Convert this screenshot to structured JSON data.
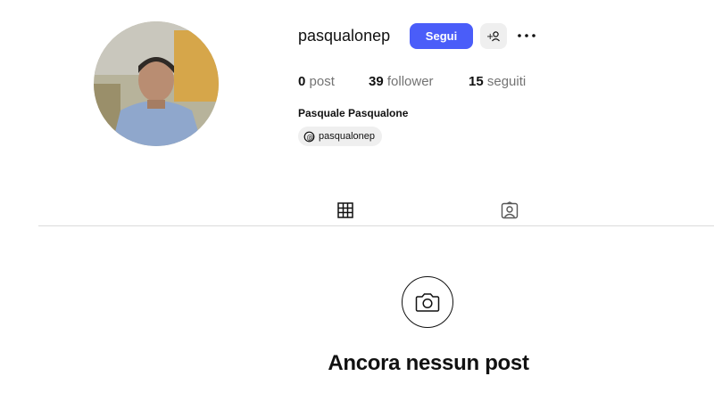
{
  "profile": {
    "username": "pasqualonep",
    "follow_label": "Segui",
    "full_name": "Pasquale Pasqualone",
    "threads_handle": "pasqualonep"
  },
  "stats": {
    "posts_count": "0",
    "posts_label": "post",
    "followers_count": "39",
    "followers_label": "follower",
    "following_count": "15",
    "following_label": "seguiti"
  },
  "tabs": {
    "posts_icon": "grid-icon",
    "tagged_icon": "tagged-user-icon"
  },
  "empty_state": {
    "icon": "camera-icon",
    "title": "Ancora nessun post"
  },
  "colors": {
    "accent": "#4a5df9",
    "secondary_button": "#efefef",
    "muted_text": "#737373"
  }
}
